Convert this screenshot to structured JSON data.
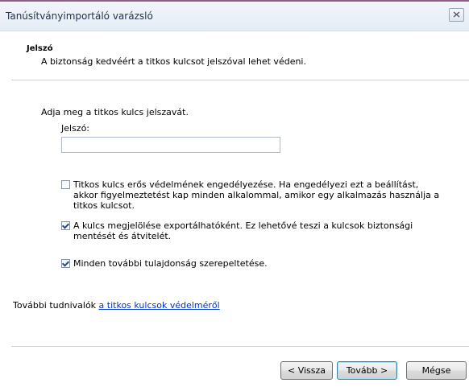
{
  "window": {
    "title": "Tanúsítványimportáló varázsló"
  },
  "header": {
    "title": "Jelszó",
    "subtitle": "A biztonság kedvéért a titkos kulcsot jelszóval lehet védeni."
  },
  "form": {
    "prompt": "Adja meg a titkos kulcs jelszavát.",
    "password_label": "Jelszó:",
    "password_value": ""
  },
  "options": [
    {
      "label": "Titkos kulcs erős védelmének engedélyezése. Ha engedélyezi ezt a beállítást, akkor figyelmeztetést kap minden alkalommal, amikor egy alkalmazás használja a titkos kulcsot.",
      "checked": false
    },
    {
      "label": "A kulcs megjelölése exportálhatóként. Ez lehetővé teszi a kulcsok biztonsági mentését és átvitelét.",
      "checked": true
    },
    {
      "label": "Minden további tulajdonság szerepeltetése.",
      "checked": true
    }
  ],
  "more_info": {
    "prefix": "További tudnivalók ",
    "link": "a titkos kulcsok védelméről"
  },
  "buttons": {
    "back": "< Vissza",
    "next": "Tovább >",
    "cancel": "Mégse"
  }
}
